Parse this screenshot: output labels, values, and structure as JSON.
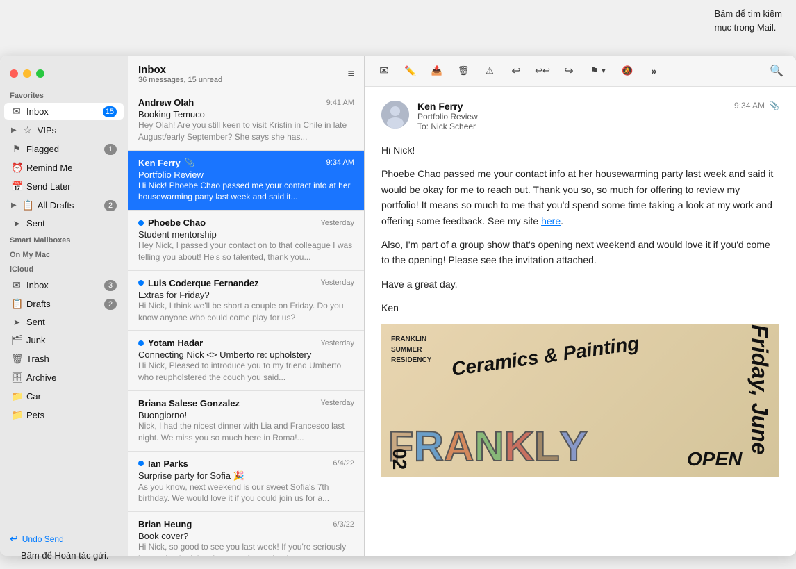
{
  "tooltip_top_right": "Bấm để tìm kiếm\nmục trong Mail.",
  "tooltip_bottom_left": "Bấm để Hoàn tác gửi.",
  "sidebar": {
    "favorites_label": "Favorites",
    "smart_mailboxes_label": "Smart Mailboxes",
    "on_my_mac_label": "On My Mac",
    "icloud_label": "iCloud",
    "items_favorites": [
      {
        "id": "inbox",
        "label": "Inbox",
        "icon": "✉",
        "badge": "15",
        "badge_blue": true,
        "active": true
      },
      {
        "id": "vips",
        "label": "VIPs",
        "icon": "★",
        "expand": true
      },
      {
        "id": "flagged",
        "label": "Flagged",
        "icon": "⚑",
        "badge": "1"
      },
      {
        "id": "remind-me",
        "label": "Remind Me",
        "icon": "⏰"
      },
      {
        "id": "send-later",
        "label": "Send Later",
        "icon": "📅"
      },
      {
        "id": "all-drafts",
        "label": "All Drafts",
        "icon": "📋",
        "expand": true,
        "badge": "2"
      },
      {
        "id": "sent",
        "label": "Sent",
        "icon": "➤"
      }
    ],
    "items_icloud": [
      {
        "id": "icloud-inbox",
        "label": "Inbox",
        "icon": "✉",
        "badge": "3"
      },
      {
        "id": "icloud-drafts",
        "label": "Drafts",
        "icon": "📋",
        "badge": "2"
      },
      {
        "id": "icloud-sent",
        "label": "Sent",
        "icon": "➤"
      },
      {
        "id": "icloud-junk",
        "label": "Junk",
        "icon": "🗂"
      },
      {
        "id": "icloud-trash",
        "label": "Trash",
        "icon": "🗑"
      },
      {
        "id": "icloud-archive",
        "label": "Archive",
        "icon": "🗄"
      },
      {
        "id": "icloud-car",
        "label": "Car",
        "icon": "📁"
      },
      {
        "id": "icloud-pets",
        "label": "Pets",
        "icon": "📁"
      }
    ],
    "undo_send_label": "Undo Send"
  },
  "message_list": {
    "title": "Inbox",
    "count": "36 messages, 15 unread",
    "messages": [
      {
        "sender": "Andrew Olah",
        "subject": "Booking Temuco",
        "preview": "Hey Olah! Are you still keen to visit Kristin in Chile in late August/early September? She says she has...",
        "time": "9:41 AM",
        "unread": false
      },
      {
        "sender": "Ken Ferry",
        "subject": "Portfolio Review",
        "preview": "Hi Nick! Phoebe Chao passed me your contact info at her housewarming party last week and said it...",
        "time": "9:34 AM",
        "unread": false,
        "selected": true,
        "has_attachment": true
      },
      {
        "sender": "Phoebe Chao",
        "subject": "Student mentorship",
        "preview": "Hey Nick, I passed your contact on to that colleague I was telling you about! He's so talented, thank you...",
        "time": "Yesterday",
        "unread": true
      },
      {
        "sender": "Luis Coderque Fernandez",
        "subject": "Extras for Friday?",
        "preview": "Hi Nick, I think we'll be short a couple on Friday. Do you know anyone who could come play for us?",
        "time": "Yesterday",
        "unread": true
      },
      {
        "sender": "Yotam Hadar",
        "subject": "Connecting Nick <> Umberto re: upholstery",
        "preview": "Hi Nick, Pleased to introduce you to my friend Umberto who reupholstered the couch you said...",
        "time": "Yesterday",
        "unread": true
      },
      {
        "sender": "Briana Salese Gonzalez",
        "subject": "Buongiorno!",
        "preview": "Nick, I had the nicest dinner with Lia and Francesco last night. We miss you so much here in Roma!...",
        "time": "Yesterday",
        "unread": false
      },
      {
        "sender": "Ian Parks",
        "subject": "Surprise party for Sofia 🎉",
        "preview": "As you know, next weekend is our sweet Sofia's 7th birthday. We would love it if you could join us for a...",
        "time": "6/4/22",
        "unread": true
      },
      {
        "sender": "Brian Heung",
        "subject": "Book cover?",
        "preview": "Hi Nick, so good to see you last week! If you're seriously interesting in doing the cover for my book,...",
        "time": "6/3/22",
        "unread": false
      }
    ]
  },
  "email_detail": {
    "from": "Ken Ferry",
    "subject": "Portfolio Review",
    "to_label": "To:",
    "to": "Nick Scheer",
    "date": "9:34 AM",
    "has_attachment": true,
    "body_lines": [
      "Hi Nick!",
      "",
      "Phoebe Chao passed me your contact info at her housewarming party last week and said it would be okay for me to reach out. Thank you so, so much for offering to review my portfolio! It means so much to me that you'd spend some time taking a look at my work and offering some feedback. See my site here.",
      "",
      "Also, I'm part of a group show that's opening next weekend and would love it if you'd come to the opening! Please see the invitation attached.",
      "",
      "Have a great day,",
      "",
      "Ken"
    ],
    "link_text": "here",
    "poster": {
      "franklin_text": "FRANKLIN\nSUMMER\nRESIDENCY",
      "ceramics_text": "Ceramics & Painting",
      "friday_text": "Friday, June",
      "big_text": "FRANKLY\nOPEN"
    }
  },
  "toolbar": {
    "icons": [
      {
        "id": "new-message",
        "symbol": "✉",
        "label": "New Message"
      },
      {
        "id": "compose",
        "symbol": "✏",
        "label": "Compose"
      },
      {
        "id": "archive",
        "symbol": "📥",
        "label": "Archive"
      },
      {
        "id": "delete",
        "symbol": "🗑",
        "label": "Delete"
      },
      {
        "id": "junk",
        "symbol": "⚠",
        "label": "Junk"
      },
      {
        "id": "reply",
        "symbol": "↩",
        "label": "Reply"
      },
      {
        "id": "reply-all",
        "symbol": "↩↩",
        "label": "Reply All"
      },
      {
        "id": "forward",
        "symbol": "↪",
        "label": "Forward"
      },
      {
        "id": "flag",
        "symbol": "⚑",
        "label": "Flag"
      },
      {
        "id": "mute",
        "symbol": "🔕",
        "label": "Mute"
      },
      {
        "id": "more",
        "symbol": "»",
        "label": "More"
      },
      {
        "id": "search",
        "symbol": "🔍",
        "label": "Search"
      }
    ]
  }
}
